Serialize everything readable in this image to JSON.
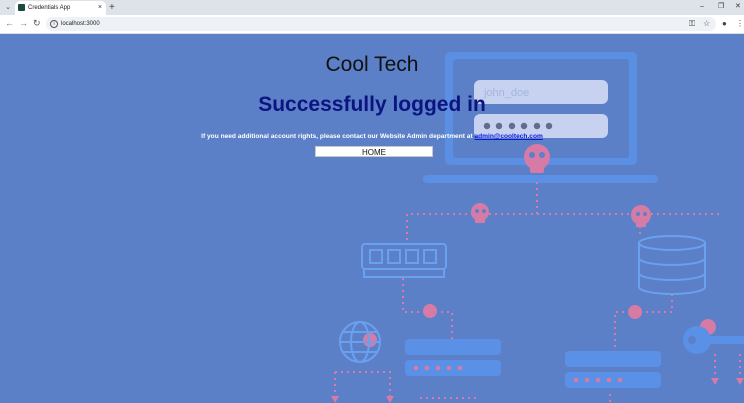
{
  "browser": {
    "tab_title": "Credentials App",
    "url": "localhost:3000",
    "new_tab_symbol": "+",
    "close_symbol": "×",
    "colors": {
      "tabbar": "#dee3ea",
      "toolbar": "#ffffff",
      "omnibox": "#eef1f6"
    }
  },
  "page": {
    "site_title": "Cool Tech",
    "heading": "Successfully logged in",
    "info_text": "If you need additional account rights, please contact our Website Admin department at",
    "admin_email": "admin@cooltech.com",
    "home_button": "HOME",
    "colors": {
      "background": "#5c80c8",
      "heading": "#0b1480",
      "link": "#0a18d8",
      "illustration_blue": "#4b94e8",
      "illustration_pink": "#d67aa6"
    }
  },
  "illustration": {
    "username_placeholder": "john_doe",
    "password_mask": "●●●●●●",
    "icons": [
      "laptop-icon",
      "skull-icon",
      "server-icon",
      "database-icon",
      "globe-icon",
      "key-icon"
    ]
  }
}
